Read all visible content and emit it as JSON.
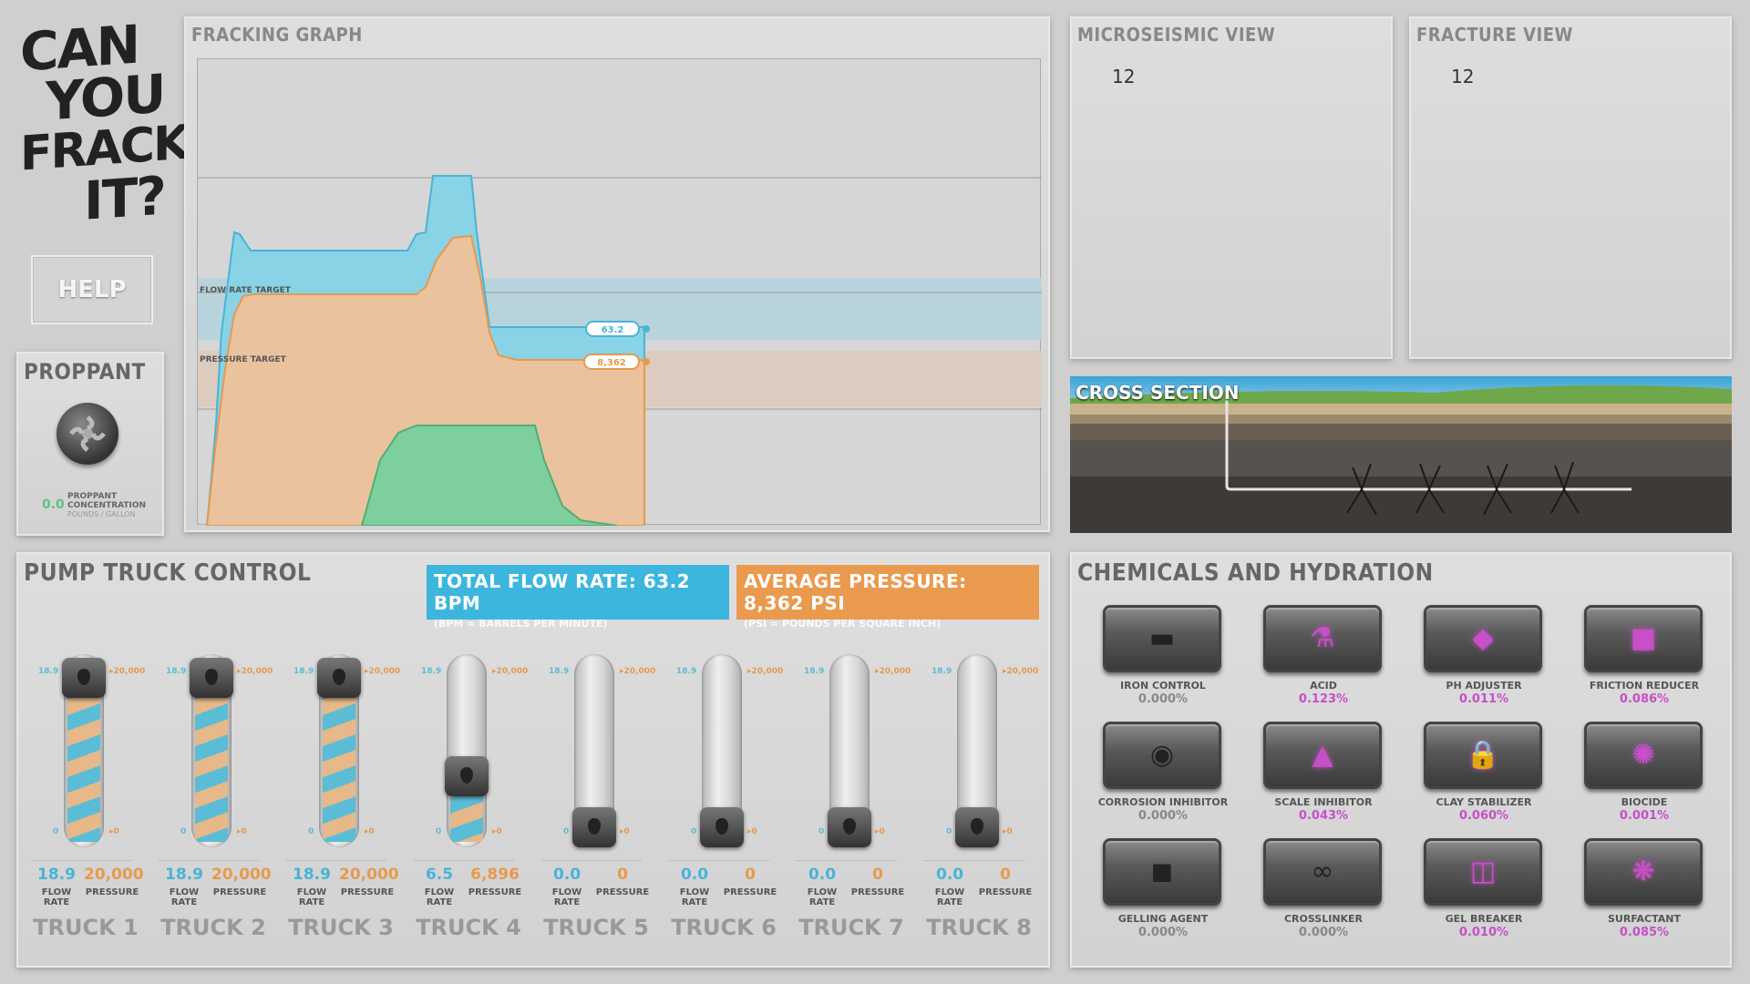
{
  "logo": {
    "lines": [
      "CAN",
      "YOU",
      "FRACK",
      "IT?"
    ]
  },
  "help": {
    "label": "HELP"
  },
  "proppant": {
    "title": "PROPPANT",
    "value": "0.0",
    "label1": "PROPPANT",
    "label2": "CONCENTRATION",
    "label3": "POUNDS / GALLON"
  },
  "graph": {
    "title": "FRACKING GRAPH",
    "flow_target_label": "FLOW RATE TARGET",
    "pressure_target_label": "PRESSURE TARGET",
    "flow_badge": "63.2",
    "pressure_badge": "8,362"
  },
  "microseismic": {
    "title": "MICROSEISMIC VIEW",
    "value": "12"
  },
  "fracture": {
    "title": "FRACTURE VIEW",
    "value": "12"
  },
  "cross_section": {
    "title": "CROSS SECTION"
  },
  "pump": {
    "title": "PUMP TRUCK CONTROL",
    "total_flow": "TOTAL FLOW RATE:  63.2 BPM",
    "total_flow_sub": "(BPM = BARRELS PER MINUTE)",
    "avg_pressure": "AVERAGE PRESSURE:  8,362 PSI",
    "avg_pressure_sub": "(PSI = POUNDS PER SQUARE INCH)",
    "flow_label": "FLOW RATE",
    "pressure_label": "PRESSURE",
    "trucks": [
      {
        "name": "TRUCK 1",
        "flow": "18.9",
        "pressure": "20,000",
        "max_flow": "18.9",
        "max_pressure": "20,000",
        "min_flow": "0",
        "min_pressure": "0",
        "level": 1.0
      },
      {
        "name": "TRUCK 2",
        "flow": "18.9",
        "pressure": "20,000",
        "max_flow": "18.9",
        "max_pressure": "20,000",
        "min_flow": "0",
        "min_pressure": "0",
        "level": 1.0
      },
      {
        "name": "TRUCK 3",
        "flow": "18.9",
        "pressure": "20,000",
        "max_flow": "18.9",
        "max_pressure": "20,000",
        "min_flow": "0",
        "min_pressure": "0",
        "level": 1.0
      },
      {
        "name": "TRUCK 4",
        "flow": "6.5",
        "pressure": "6,896",
        "max_flow": "18.9",
        "max_pressure": "20,000",
        "min_flow": "0",
        "min_pressure": "0",
        "level": 0.34
      },
      {
        "name": "TRUCK 5",
        "flow": "0.0",
        "pressure": "0",
        "max_flow": "18.9",
        "max_pressure": "20,000",
        "min_flow": "0",
        "min_pressure": "0",
        "level": 0.0
      },
      {
        "name": "TRUCK 6",
        "flow": "0.0",
        "pressure": "0",
        "max_flow": "18.9",
        "max_pressure": "20,000",
        "min_flow": "0",
        "min_pressure": "0",
        "level": 0.0
      },
      {
        "name": "TRUCK 7",
        "flow": "0.0",
        "pressure": "0",
        "max_flow": "18.9",
        "max_pressure": "20,000",
        "min_flow": "0",
        "min_pressure": "0",
        "level": 0.0
      },
      {
        "name": "TRUCK 8",
        "flow": "0.0",
        "pressure": "0",
        "max_flow": "18.9",
        "max_pressure": "20,000",
        "min_flow": "0",
        "min_pressure": "0",
        "level": 0.0
      }
    ]
  },
  "chemicals": {
    "title": "CHEMICALS AND HYDRATION",
    "items": [
      {
        "name": "IRON CONTROL",
        "value": "0.000%",
        "icon": "iron-bars-icon",
        "active": false
      },
      {
        "name": "ACID",
        "value": "0.123%",
        "icon": "flask-icon",
        "active": true
      },
      {
        "name": "PH ADJUSTER",
        "value": "0.011%",
        "icon": "ph-icon",
        "active": true
      },
      {
        "name": "FRICTION REDUCER",
        "value": "0.086%",
        "icon": "friction-icon",
        "active": true
      },
      {
        "name": "CORROSION INHIBITOR",
        "value": "0.000%",
        "icon": "corrosion-icon",
        "active": false
      },
      {
        "name": "SCALE INHIBITOR",
        "value": "0.043%",
        "icon": "scale-icon",
        "active": true
      },
      {
        "name": "CLAY STABILIZER",
        "value": "0.060%",
        "icon": "lock-icon",
        "active": true
      },
      {
        "name": "BIOCIDE",
        "value": "0.001%",
        "icon": "biocide-icon",
        "active": true
      },
      {
        "name": "GELLING AGENT",
        "value": "0.000%",
        "icon": "box-icon",
        "active": false
      },
      {
        "name": "CROSSLINKER",
        "value": "0.000%",
        "icon": "link-icon",
        "active": false
      },
      {
        "name": "GEL BREAKER",
        "value": "0.010%",
        "icon": "broken-box-icon",
        "active": true
      },
      {
        "name": "SURFACTANT",
        "value": "0.085%",
        "icon": "surfactant-icon",
        "active": true
      }
    ]
  },
  "colors": {
    "flow": "#5bbcd6",
    "pressure": "#e59a4f",
    "proppant": "#5fc084",
    "chem_active": "#c84fc8",
    "chem_inactive": "#888888"
  }
}
